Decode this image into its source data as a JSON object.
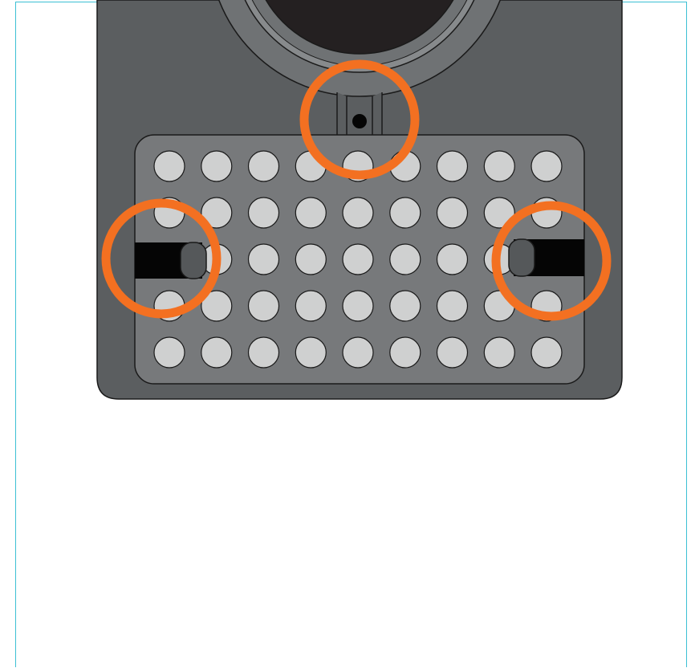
{
  "colors": {
    "frame_border": "#3cc0d4",
    "device_body": "#5b5e60",
    "device_outline": "#1a1a1a",
    "lens_outer_ring": "#6f7274",
    "lens_mid_ring": "#878a8c",
    "lens_inner": "#242021",
    "plate": "#77797b",
    "hole_fill": "#cfd0d0",
    "slot": "#050505",
    "slider_knob": "#55585a",
    "highlight_ring": "#f37021",
    "clip_dot": "#050505"
  },
  "diagram": {
    "grid_rows": 5,
    "grid_columns": 9,
    "highlighted_features": [
      "lens-clip",
      "left-slot-latch",
      "right-slot-latch"
    ]
  }
}
